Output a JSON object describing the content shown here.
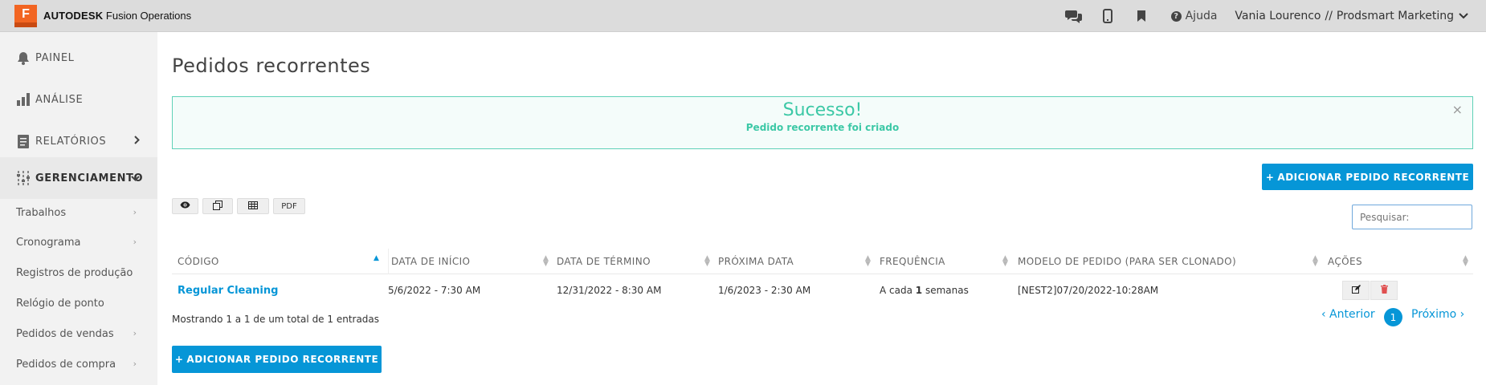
{
  "topbar": {
    "brand_bold": "AUTODESK",
    "brand_rest": " Fusion Operations",
    "logo_letter": "F",
    "help_label": "Ajuda",
    "user_name": "Vania Lourenco",
    "user_separator": "//",
    "company": "Prodsmart Marketing",
    "icons": [
      "chat-icon",
      "mobile-icon",
      "bookmark-icon",
      "help-icon",
      "chevron-down-icon"
    ]
  },
  "sidebar": {
    "items": [
      {
        "label": "PAINEL",
        "icon": "bell-icon"
      },
      {
        "label": "ANÁLISE",
        "icon": "bar-chart-icon"
      },
      {
        "label": "RELATÓRIOS",
        "icon": "document-icon"
      },
      {
        "label": "GERENCIAMENTO",
        "icon": "sliders-icon"
      }
    ],
    "subitems": [
      {
        "label": "Trabalhos"
      },
      {
        "label": "Cronograma"
      },
      {
        "label": "Registros de produção"
      },
      {
        "label": "Relógio de ponto"
      },
      {
        "label": "Pedidos de vendas"
      },
      {
        "label": "Pedidos de compra"
      }
    ]
  },
  "main": {
    "title": "Pedidos recorrentes",
    "alert": {
      "title": "Sucesso!",
      "message": "Pedido recorrente foi criado",
      "close": "×"
    },
    "add_button_label": "ADICIONAR PEDIDO RECORRENTE",
    "add_button_plus": "+",
    "tools": {
      "pdf_label": "PDF"
    },
    "search_placeholder": "Pesquisar:",
    "table": {
      "headers": [
        "CÓDIGO",
        "DATA DE INÍCIO",
        "DATA DE TÉRMINO",
        "PRÓXIMA DATA",
        "FREQUÊNCIA",
        "MODELO DE PEDIDO (PARA SER CLONADO)",
        "AÇÕES"
      ],
      "rows": [
        {
          "code": "Regular Cleaning",
          "start": "5/6/2022 - 7:30 AM",
          "end": "12/31/2022 - 8:30 AM",
          "next": "1/6/2023 - 2:30 AM",
          "freq_prefix": "A cada ",
          "freq_num": "1",
          "freq_suffix": " semanas",
          "template": "[NEST2]07/20/2022-10:28AM"
        }
      ]
    },
    "info": "Mostrando 1 a 1 de um total de 1 entradas",
    "pagination": {
      "prev": "‹ Anterior",
      "current": "1",
      "next": "Próximo ›"
    }
  }
}
